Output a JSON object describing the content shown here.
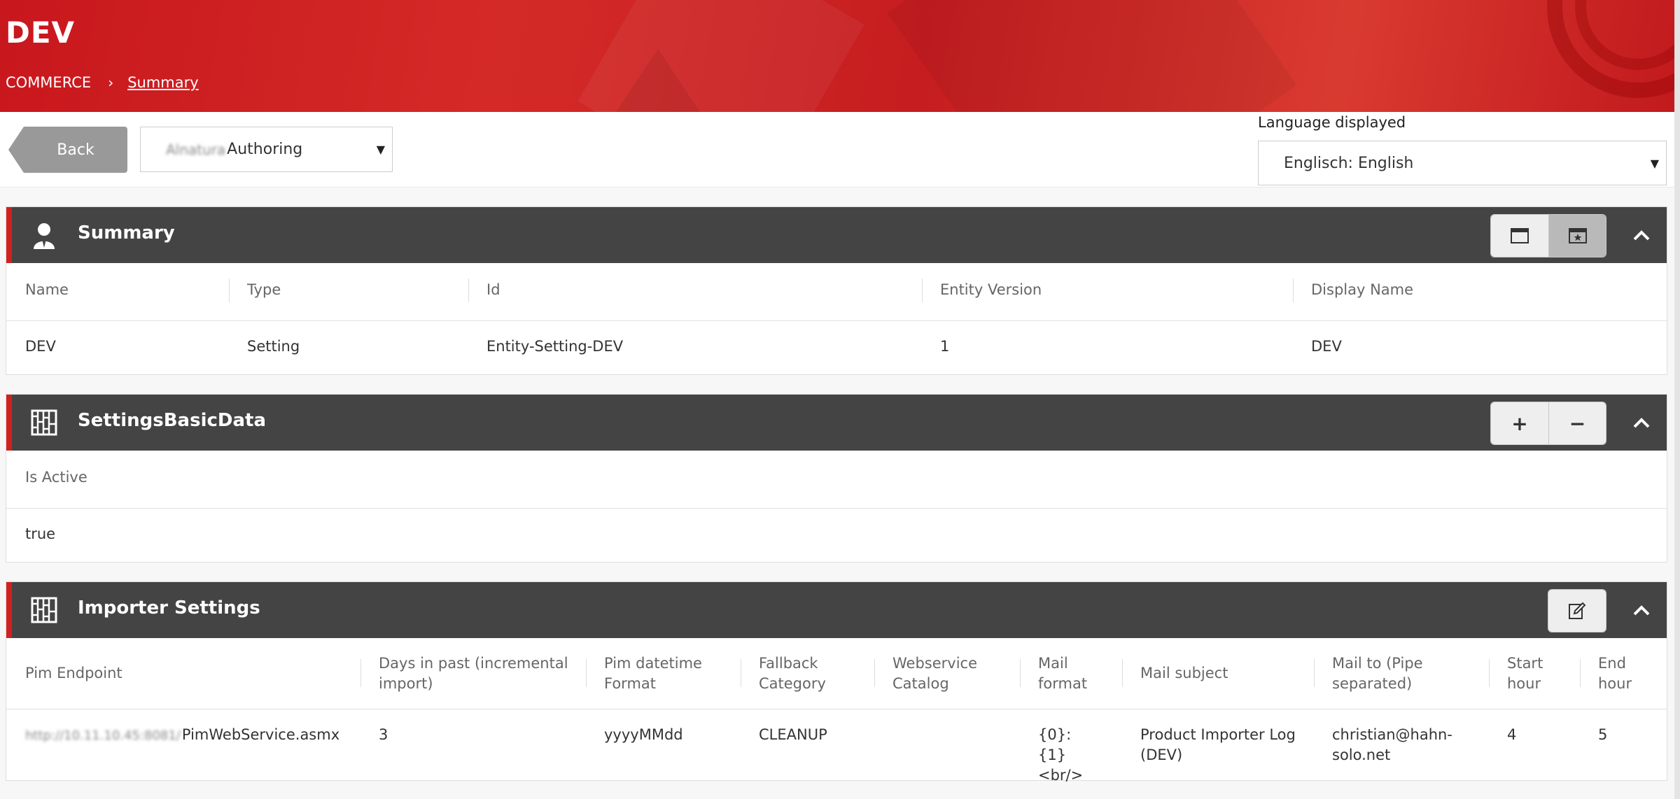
{
  "header": {
    "title": "DEV",
    "breadcrumb": {
      "root": "COMMERCE",
      "separator": "›",
      "current": "Summary"
    }
  },
  "toolbar": {
    "back_label": "Back",
    "workspace": {
      "blurred_prefix": "Alnatura",
      "value": "Authoring"
    },
    "language": {
      "label": "Language displayed",
      "value": "Englisch: English"
    }
  },
  "panels": {
    "summary": {
      "title": "Summary",
      "icon": "user-icon",
      "columns": [
        "Name",
        "Type",
        "Id",
        "Entity Version",
        "Display Name"
      ],
      "row": [
        "DEV",
        "Setting",
        "Entity-Setting-DEV",
        "1",
        "DEV"
      ]
    },
    "basic": {
      "title": "SettingsBasicData",
      "icon": "grid-icon",
      "columns": [
        "Is Active"
      ],
      "row": [
        "true"
      ],
      "add_label": "+",
      "remove_label": "−"
    },
    "importer": {
      "title": "Importer Settings",
      "icon": "grid-icon",
      "columns": [
        "Pim Endpoint",
        "Days in past (incremental import)",
        "Pim datetime Format",
        "Fallback Category",
        "Webservice Catalog",
        "Mail format",
        "Mail subject",
        "Mail to (Pipe separated)",
        "Start hour",
        "End hour"
      ],
      "row": {
        "endpoint_blurred": "http://10.11.10.45:8081/",
        "endpoint": "PimWebService.asmx",
        "days": "3",
        "datetime_format": "yyyyMMdd",
        "fallback_category": "CLEANUP",
        "webservice_catalog": "",
        "mail_format": "{0}: {1} <br/>",
        "mail_subject": "Product Importer Log (DEV)",
        "mail_to": "christian@hahn-solo.net",
        "start_hour": "4",
        "end_hour": "5"
      }
    }
  },
  "colors": {
    "accent": "#d0201f",
    "panel_header": "#444444",
    "header_red": "#c8171d"
  }
}
